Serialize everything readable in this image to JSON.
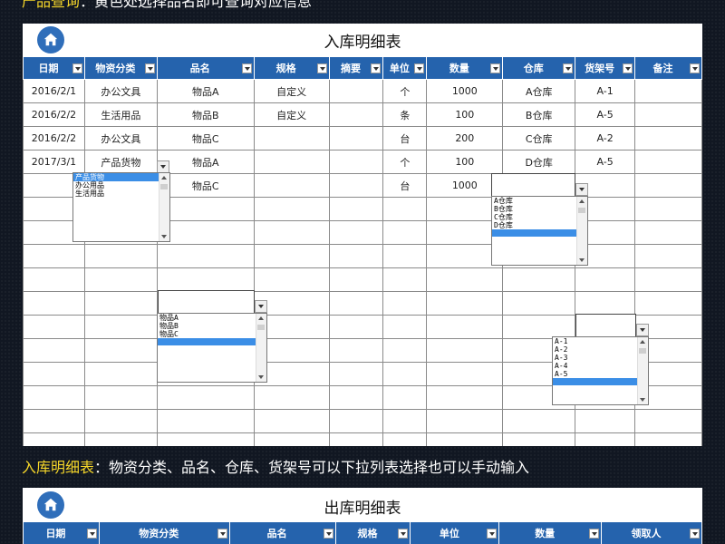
{
  "captions": {
    "top_highlight": "产品查询",
    "top_text": "：黄色处选择品名即可查询对应信息",
    "mid_highlight": "入库明细表",
    "mid_text": "：物资分类、品名、仓库、货架号可以下拉列表选择也可以手动输入"
  },
  "inbound": {
    "title": "入库明细表",
    "columns": [
      "日期",
      "物资分类",
      "品名",
      "规格",
      "摘要",
      "单位",
      "数量",
      "仓库",
      "货架号",
      "备注"
    ],
    "rows": [
      [
        "2016/2/1",
        "办公文具",
        "物品A",
        "自定义",
        "",
        "个",
        "1000",
        "A仓库",
        "A-1",
        ""
      ],
      [
        "2016/2/2",
        "生活用品",
        "物品B",
        "自定义",
        "",
        "条",
        "100",
        "B仓库",
        "A-5",
        ""
      ],
      [
        "2016/2/2",
        "办公文具",
        "物品C",
        "",
        "",
        "台",
        "200",
        "C仓库",
        "A-2",
        ""
      ],
      [
        "2017/3/1",
        "产品货物",
        "物品A",
        "",
        "",
        "个",
        "100",
        "D仓库",
        "A-5",
        ""
      ],
      [
        "",
        "",
        "物品C",
        "",
        "",
        "台",
        "1000",
        "",
        "",
        ""
      ],
      [
        "",
        "",
        "",
        "",
        "",
        "",
        "",
        "",
        "",
        ""
      ],
      [
        "",
        "",
        "",
        "",
        "",
        "",
        "",
        "",
        "",
        ""
      ],
      [
        "",
        "",
        "",
        "",
        "",
        "",
        "",
        "",
        "",
        ""
      ],
      [
        "",
        "",
        "",
        "",
        "",
        "",
        "",
        "",
        "",
        ""
      ],
      [
        "",
        "",
        "",
        "",
        "",
        "",
        "",
        "",
        "",
        ""
      ],
      [
        "",
        "",
        "",
        "",
        "",
        "",
        "",
        "",
        "",
        ""
      ],
      [
        "",
        "",
        "",
        "",
        "",
        "",
        "",
        "",
        "",
        ""
      ],
      [
        "",
        "",
        "",
        "",
        "",
        "",
        "",
        "",
        "",
        ""
      ],
      [
        "",
        "",
        "",
        "",
        "",
        "",
        "",
        "",
        "",
        ""
      ],
      [
        "",
        "",
        "",
        "",
        "",
        "",
        "",
        "",
        "",
        ""
      ],
      [
        "",
        "",
        "",
        "",
        "",
        "",
        "",
        "",
        "",
        ""
      ]
    ]
  },
  "dropdowns": {
    "category": {
      "options": [
        "产品货物",
        "办公用品",
        "生活用品"
      ],
      "selected": "产品货物"
    },
    "product": {
      "options": [
        "物品A",
        "物品B",
        "物品C"
      ]
    },
    "warehouse": {
      "options": [
        "A仓库",
        "B仓库",
        "C仓库",
        "D仓库"
      ]
    },
    "shelf": {
      "options": [
        "A-1",
        "A-2",
        "A-3",
        "A-4",
        "A-5"
      ]
    }
  },
  "outbound": {
    "title": "出库明细表",
    "columns": [
      "日期",
      "物资分类",
      "品名",
      "规格",
      "单位",
      "数量",
      "领取人"
    ]
  },
  "colors": {
    "header_blue": "#2563ad",
    "highlight_yellow": "#f5d629",
    "selection_blue": "#3b8ee6"
  },
  "icons": {
    "home": "home-icon"
  }
}
